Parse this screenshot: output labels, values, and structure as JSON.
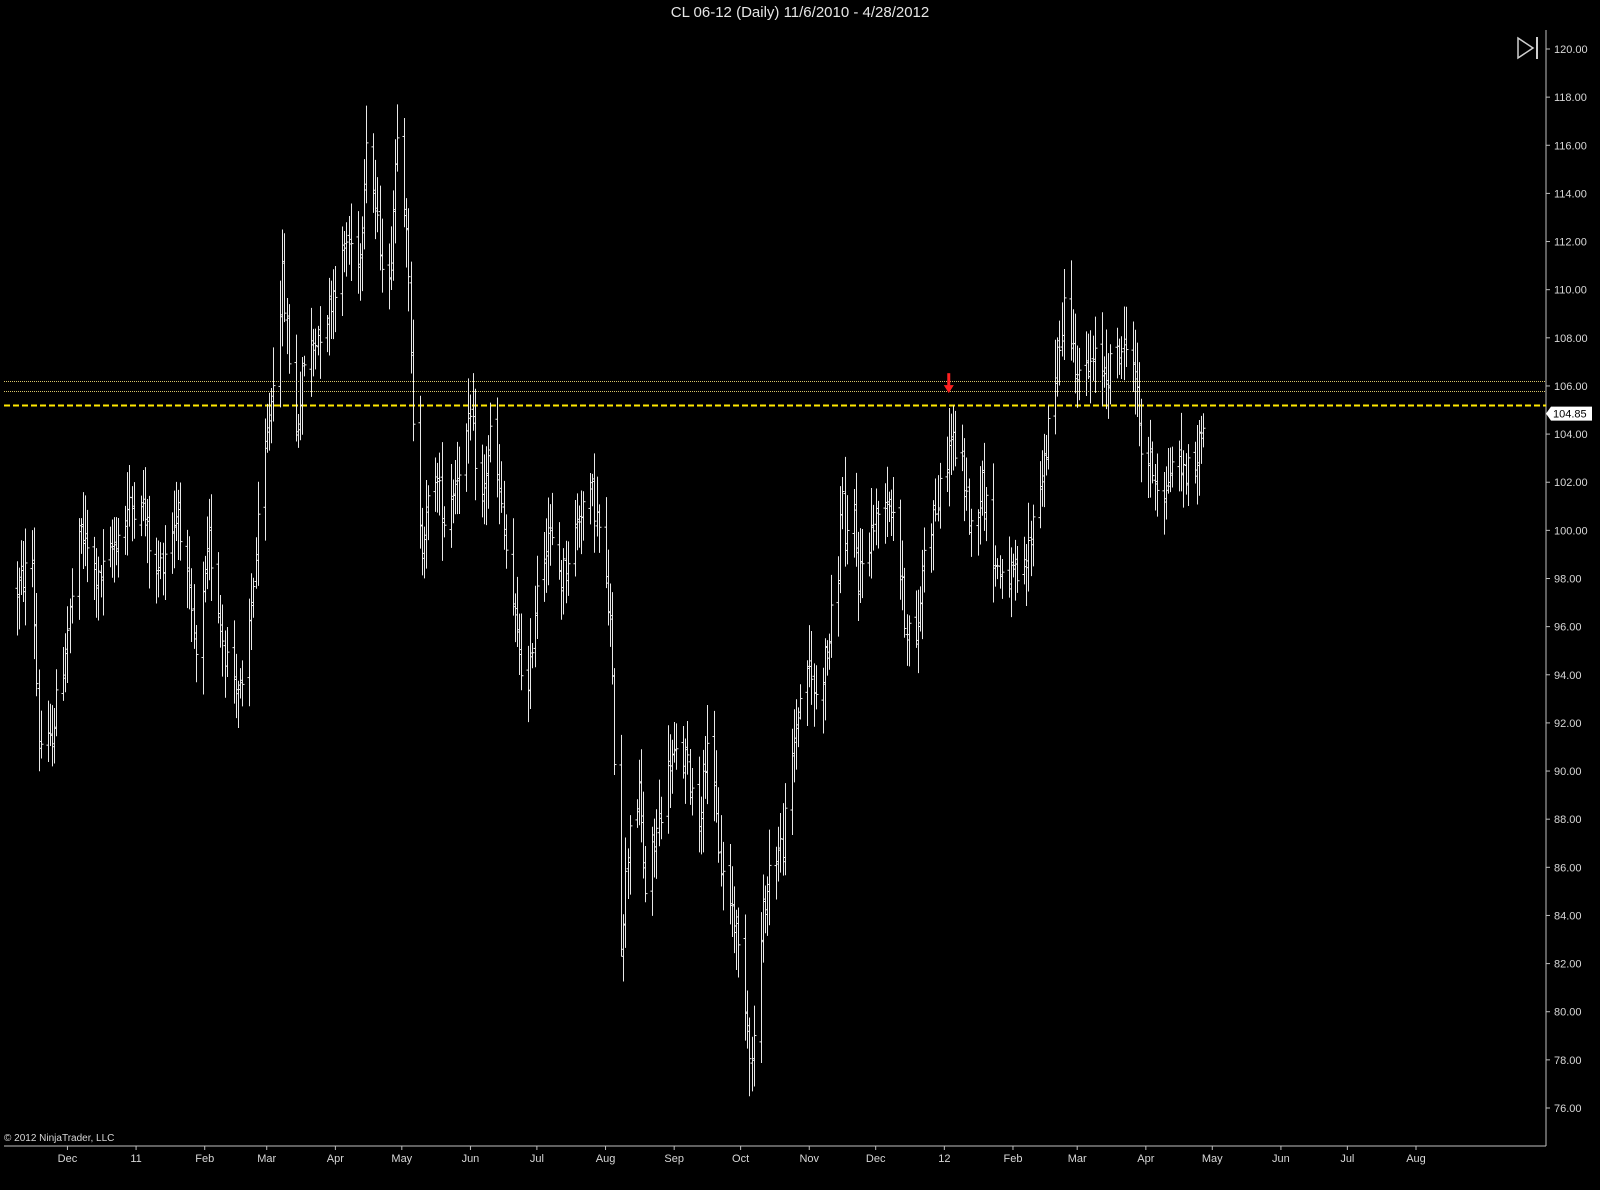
{
  "window": {
    "title": "CL 06-12 (Daily)  11/6/2010 - 4/28/2012"
  },
  "copyright": "© 2012 NinjaTrader, LLC",
  "icons": {
    "scroll_end": "play-to-end-icon"
  },
  "colors": {
    "background": "#000000",
    "bars": "#e8e8e8",
    "axis": "#bfbfbf",
    "line_solid": "#d6c36a",
    "line_dashed": "#ffe800",
    "arrow": "#ff2020",
    "price_tag_bg": "#ffffff"
  },
  "chart_data": {
    "type": "ohlc",
    "instrument": "CL 06-12",
    "interval": "Daily",
    "date_range": [
      "11/6/2010",
      "4/28/2012"
    ],
    "ylim": [
      75.0,
      120.5
    ],
    "y_ticks": [
      "76.00",
      "78.00",
      "80.00",
      "82.00",
      "84.00",
      "86.00",
      "88.00",
      "90.00",
      "92.00",
      "94.00",
      "96.00",
      "98.00",
      "100.00",
      "102.00",
      "104.00",
      "106.00",
      "108.00",
      "110.00",
      "112.00",
      "114.00",
      "116.00",
      "118.00",
      "120.00"
    ],
    "x_tick_labels": [
      "Dec",
      "11",
      "Feb",
      "Mar",
      "Apr",
      "May",
      "Jun",
      "Jul",
      "Aug",
      "Sep",
      "Oct",
      "Nov",
      "Dec",
      "12",
      "Feb",
      "Mar",
      "Apr",
      "May",
      "Jun",
      "Jul",
      "Aug"
    ],
    "x_tick_months": [
      "2010-12",
      "2011-01",
      "2011-02",
      "2011-03",
      "2011-04",
      "2011-05",
      "2011-06",
      "2011-07",
      "2011-08",
      "2011-09",
      "2011-10",
      "2011-11",
      "2011-12",
      "2012-01",
      "2012-02",
      "2012-03",
      "2012-04",
      "2012-05",
      "2012-06",
      "2012-07",
      "2012-08"
    ],
    "last_price": "104.85",
    "horizontal_lines": [
      {
        "price": 106.2,
        "style": "dotted"
      },
      {
        "price": 105.8,
        "style": "dotted"
      },
      {
        "price": 105.2,
        "style": "dashed"
      }
    ],
    "markers": [
      {
        "date": "2012-01-03",
        "price": 105.7,
        "type": "down-arrow"
      }
    ],
    "swing_points": [
      [
        "2010-11-08",
        97.5
      ],
      [
        "2010-11-15",
        98.8
      ],
      [
        "2010-11-18",
        91.2
      ],
      [
        "2010-11-23",
        91.0
      ],
      [
        "2010-11-29",
        94.5
      ],
      [
        "2010-12-07",
        100.0
      ],
      [
        "2010-12-15",
        97.8
      ],
      [
        "2010-12-28",
        100.8
      ],
      [
        "2011-01-03",
        101.5
      ],
      [
        "2011-01-10",
        98.0
      ],
      [
        "2011-01-20",
        101.0
      ],
      [
        "2011-01-28",
        94.5
      ],
      [
        "2011-02-03",
        99.5
      ],
      [
        "2011-02-10",
        95.0
      ],
      [
        "2011-02-18",
        93.0
      ],
      [
        "2011-02-23",
        98.0
      ],
      [
        "2011-02-28",
        103.0
      ],
      [
        "2011-03-04",
        106.5
      ],
      [
        "2011-03-08",
        110.5
      ],
      [
        "2011-03-14",
        104.0
      ],
      [
        "2011-03-18",
        107.0
      ],
      [
        "2011-03-28",
        109.0
      ],
      [
        "2011-04-06",
        112.0
      ],
      [
        "2011-04-12",
        111.5
      ],
      [
        "2011-04-15",
        116.5
      ],
      [
        "2011-04-20",
        112.5
      ],
      [
        "2011-04-25",
        110.0
      ],
      [
        "2011-04-29",
        117.0
      ],
      [
        "2011-05-03",
        113.0
      ],
      [
        "2011-05-06",
        104.0
      ],
      [
        "2011-05-10",
        99.5
      ],
      [
        "2011-05-16",
        102.5
      ],
      [
        "2011-05-20",
        100.5
      ],
      [
        "2011-05-26",
        102.5
      ],
      [
        "2011-06-01",
        104.5
      ],
      [
        "2011-06-06",
        101.0
      ],
      [
        "2011-06-10",
        104.0
      ],
      [
        "2011-06-14",
        101.5
      ],
      [
        "2011-06-21",
        96.0
      ],
      [
        "2011-06-27",
        93.0
      ],
      [
        "2011-07-01",
        98.0
      ],
      [
        "2011-07-06",
        100.0
      ],
      [
        "2011-07-12",
        98.0
      ],
      [
        "2011-07-21",
        101.0
      ],
      [
        "2011-07-26",
        101.5
      ],
      [
        "2011-07-29",
        100.0
      ],
      [
        "2011-08-03",
        96.0
      ],
      [
        "2011-08-08",
        83.0
      ],
      [
        "2011-08-12",
        88.0
      ],
      [
        "2011-08-16",
        89.0
      ],
      [
        "2011-08-19",
        85.0
      ],
      [
        "2011-08-24",
        87.5
      ],
      [
        "2011-08-30",
        90.5
      ],
      [
        "2011-09-06",
        90.5
      ],
      [
        "2011-09-12",
        88.0
      ],
      [
        "2011-09-16",
        91.5
      ],
      [
        "2011-09-22",
        86.0
      ],
      [
        "2011-09-28",
        84.0
      ],
      [
        "2011-10-03",
        80.5
      ],
      [
        "2011-10-06",
        77.8
      ],
      [
        "2011-10-11",
        84.0
      ],
      [
        "2011-10-14",
        86.0
      ],
      [
        "2011-10-20",
        87.0
      ],
      [
        "2011-10-26",
        92.0
      ],
      [
        "2011-10-31",
        94.5
      ],
      [
        "2011-11-04",
        93.0
      ],
      [
        "2011-11-10",
        95.5
      ],
      [
        "2011-11-14",
        98.5
      ],
      [
        "2011-11-16",
        102.0
      ],
      [
        "2011-11-17",
        99.0
      ],
      [
        "2011-11-21",
        100.5
      ],
      [
        "2011-11-23",
        98.0
      ],
      [
        "2011-11-29",
        100.0
      ],
      [
        "2011-12-05",
        101.5
      ],
      [
        "2011-12-09",
        101.0
      ],
      [
        "2011-12-14",
        96.5
      ],
      [
        "2011-12-19",
        95.0
      ],
      [
        "2011-12-23",
        99.5
      ],
      [
        "2011-12-30",
        101.5
      ],
      [
        "2012-01-04",
        104.0
      ],
      [
        "2012-01-09",
        102.5
      ],
      [
        "2012-01-13",
        100.0
      ],
      [
        "2012-01-18",
        102.0
      ],
      [
        "2012-01-24",
        98.5
      ],
      [
        "2012-01-31",
        98.0
      ],
      [
        "2012-02-06",
        98.0
      ],
      [
        "2012-02-10",
        100.5
      ],
      [
        "2012-02-17",
        104.0
      ],
      [
        "2012-02-24",
        109.5
      ],
      [
        "2012-02-29",
        107.0
      ],
      [
        "2012-03-05",
        106.5
      ],
      [
        "2012-03-09",
        107.0
      ],
      [
        "2012-03-14",
        106.5
      ],
      [
        "2012-03-20",
        107.5
      ],
      [
        "2012-03-26",
        107.5
      ],
      [
        "2012-03-30",
        103.5
      ],
      [
        "2012-04-04",
        102.5
      ],
      [
        "2012-04-10",
        101.5
      ],
      [
        "2012-04-13",
        103.0
      ],
      [
        "2012-04-18",
        102.5
      ],
      [
        "2012-04-23",
        102.5
      ],
      [
        "2012-04-27",
        104.8
      ]
    ]
  }
}
